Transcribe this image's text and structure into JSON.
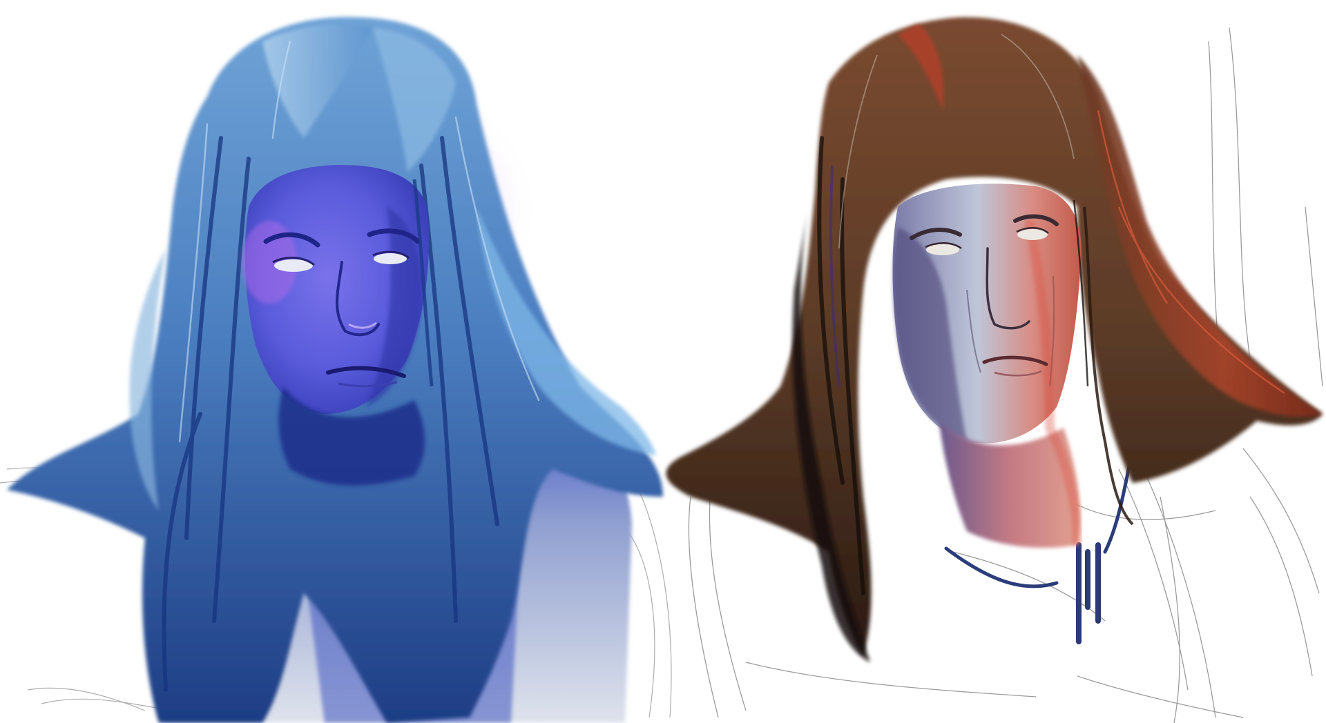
{
  "artwork": {
    "panels": [
      {
        "id": "blue-portrait",
        "palette": {
          "hair_light": "#7fb2dd",
          "hair_mid": "#4a7fc0",
          "hair_dark": "#1c3f86",
          "skin": "#5e63e0",
          "skin_highlight": "#9e7bf0",
          "skin_shadow": "#2c33a8",
          "body": "#c4cadc",
          "eyes": "#e8eaf5"
        }
      },
      {
        "id": "warm-portrait",
        "palette": {
          "hair_light": "#8a5a3c",
          "hair_mid": "#5a3a26",
          "hair_dark": "#24160f",
          "hair_red": "#b53a22",
          "skin": "#c6ccd8",
          "skin_warm": "#d96a5c",
          "skin_shadow": "#6a5f88",
          "eyes": "#ece8e2"
        }
      }
    ],
    "sketch_line_color": "#7a7a7a",
    "background_color": "#ffffff"
  }
}
